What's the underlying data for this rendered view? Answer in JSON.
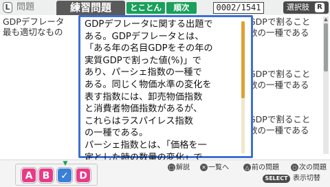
{
  "header": {
    "l_button": "L",
    "tab_label": "問題",
    "title": "練習問題",
    "mode": "とことん",
    "order": "順次",
    "counter": "0002/1541",
    "choices_label": "選択肢",
    "r_button": "R"
  },
  "background": {
    "question_line1": "GDPデフレータ",
    "question_line2": "最も適切なもの",
    "choice_texts": [
      "GDPで割ること",
      "数の一種である",
      "GDPで割ること",
      "数の一種である",
      "GDPで割ること",
      "数の一種である"
    ]
  },
  "popup": {
    "text": "GDPデフレータに関する出題で\nある。GDPデフレータとは、\n「ある年の名目GDPをその年の\n実質GDPで割った値(%)」で\nあり、パーシェ指数の一種で\nある。同じく物価水準の変化を\n表す指数には、卸売物価指数\nと消費者物価指数があるが、\nこれらはラスパイレス指数\nの一種である。\nパーシェ指数とは、「価格を一\n定とした時の数量の変化」で"
  },
  "answers": {
    "a": "A",
    "b": "B",
    "c": "✓",
    "d": "D",
    "selected_marker": "▼"
  },
  "footer": {
    "hint_explain": "解説",
    "hint_list": "一覧へ",
    "hint_prev": "前の問題",
    "hint_next": "次の問題",
    "select_button": "SELECT",
    "select_label": "表示切替"
  },
  "colors": {
    "accent_blue": "#3d6fd4",
    "badge_green": "#1aa05a",
    "answer_pink": "#e83a86",
    "answer_blue": "#3a7fd8"
  }
}
